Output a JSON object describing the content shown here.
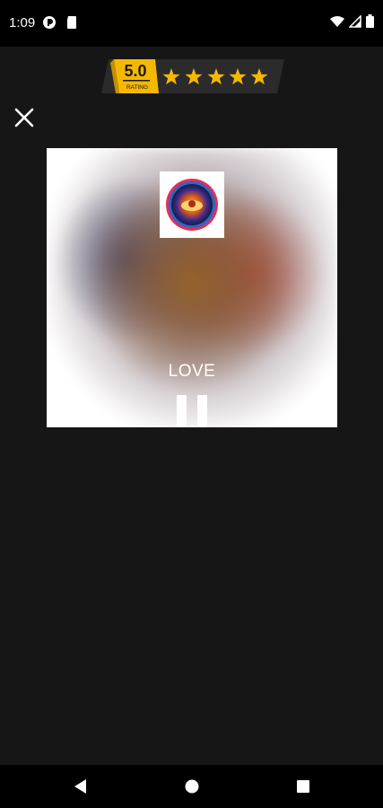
{
  "status_bar": {
    "time": "1:09",
    "left_icons": [
      "app-notification-icon",
      "sd-card-icon"
    ],
    "right_icons": [
      "wifi-icon",
      "cell-signal-icon",
      "battery-icon"
    ]
  },
  "rating_badge": {
    "score": "5.0",
    "label": "RATING",
    "stars": 5,
    "accent_color": "#f5b800"
  },
  "player": {
    "song_title": "LOVE",
    "state_icon": "pause-icon"
  },
  "close_icon": "close-icon",
  "nav_bar": {
    "items": [
      "back-icon",
      "home-icon",
      "recents-icon"
    ]
  },
  "colors": {
    "background": "#161616",
    "status_bar": "#000000",
    "nav_bar": "#000000",
    "card": "#ffffff",
    "text": "#ffffff"
  }
}
